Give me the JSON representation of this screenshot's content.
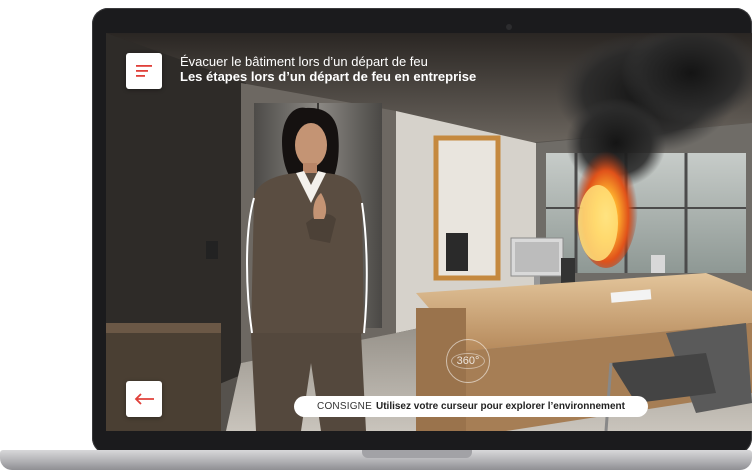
{
  "header": {
    "subtitle": "Évacuer le bâtiment lors d’un départ de feu",
    "title": "Les étapes lors d’un départ de feu en entreprise"
  },
  "consigne": {
    "label": "CONSIGNE",
    "text": "Utilisez votre curseur pour explorer l’environnement"
  },
  "badge": {
    "label": "360°"
  },
  "icons": {
    "menu": "hamburger-menu-icon",
    "back": "arrow-left-icon"
  },
  "colors": {
    "accent": "#e0403a",
    "button_bg": "#ffffff"
  }
}
